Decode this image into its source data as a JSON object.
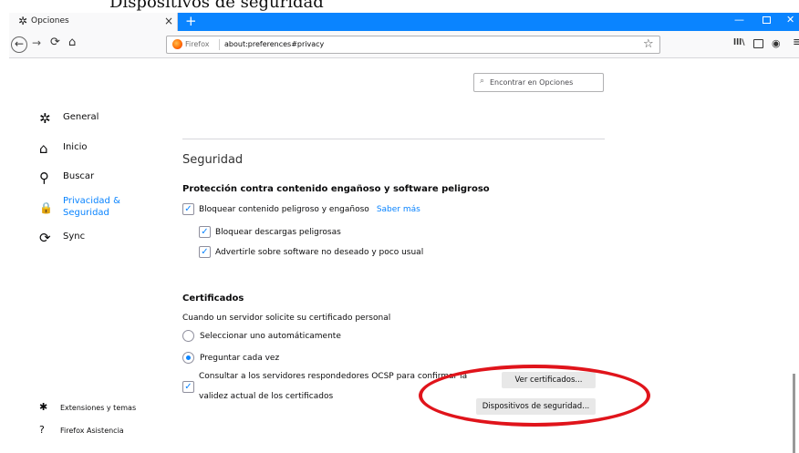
{
  "caption": "Dispositivos de seguridad",
  "tab": {
    "icon": "gear-icon",
    "title": "Opciones",
    "close": "×",
    "new": "+"
  },
  "window_controls": {
    "minimize": "—",
    "close": "✕"
  },
  "nav": {
    "back": "←",
    "forward": "→",
    "reload": "⟳",
    "home": "⌂",
    "identity_label": "Firefox",
    "url": "about:preferences#privacy",
    "bookmark": "☆",
    "library": "lll\\",
    "account": "◉",
    "menu": "≡"
  },
  "search": {
    "icon": "⌕",
    "placeholder": "Encontrar en Opciones"
  },
  "sidebar": {
    "items": [
      {
        "icon": "gear-icon",
        "glyph": "✲",
        "label": "General"
      },
      {
        "icon": "home-icon",
        "glyph": "⌂",
        "label": "Inicio"
      },
      {
        "icon": "search-icon",
        "glyph": "⚲",
        "label": "Buscar"
      },
      {
        "icon": "lock-icon",
        "glyph": "🔒",
        "label": "Privacidad & Seguridad",
        "selected": true
      },
      {
        "icon": "sync-icon",
        "glyph": "⟳",
        "label": "Sync"
      }
    ],
    "footer": [
      {
        "icon": "puzzle-icon",
        "glyph": "✱",
        "label": "Extensiones y temas"
      },
      {
        "icon": "help-icon",
        "glyph": "?",
        "label": "Firefox Asistencia"
      }
    ]
  },
  "security": {
    "title": "Seguridad",
    "protection_title": "Protección contra contenido engañoso y software peligroso",
    "block_dangerous": {
      "label": "Bloquear contenido peligroso y engañoso",
      "checked": true
    },
    "learn_more": "Saber más",
    "block_downloads": {
      "label": "Bloquear descargas peligrosas",
      "checked": true
    },
    "warn_software": {
      "label": "Advertirle sobre software no deseado y poco usual",
      "checked": true
    }
  },
  "certificates": {
    "title": "Certificados",
    "description": "Cuando un servidor solicite su certificado personal",
    "option_auto": {
      "label": "Seleccionar uno automáticamente",
      "selected": false
    },
    "option_ask": {
      "label": "Preguntar cada vez",
      "selected": true
    },
    "ocsp_line1": "Consultar a los servidores respondedores OCSP para confirmar la",
    "ocsp_line2": "validez actual de los certificados",
    "ocsp_checked": true,
    "view_button": "Ver certificados...",
    "devices_button": "Dispositivos de seguridad..."
  },
  "check_glyph": "✓",
  "annotation_color": "#e0141b",
  "accent_color": "#0a84ff"
}
